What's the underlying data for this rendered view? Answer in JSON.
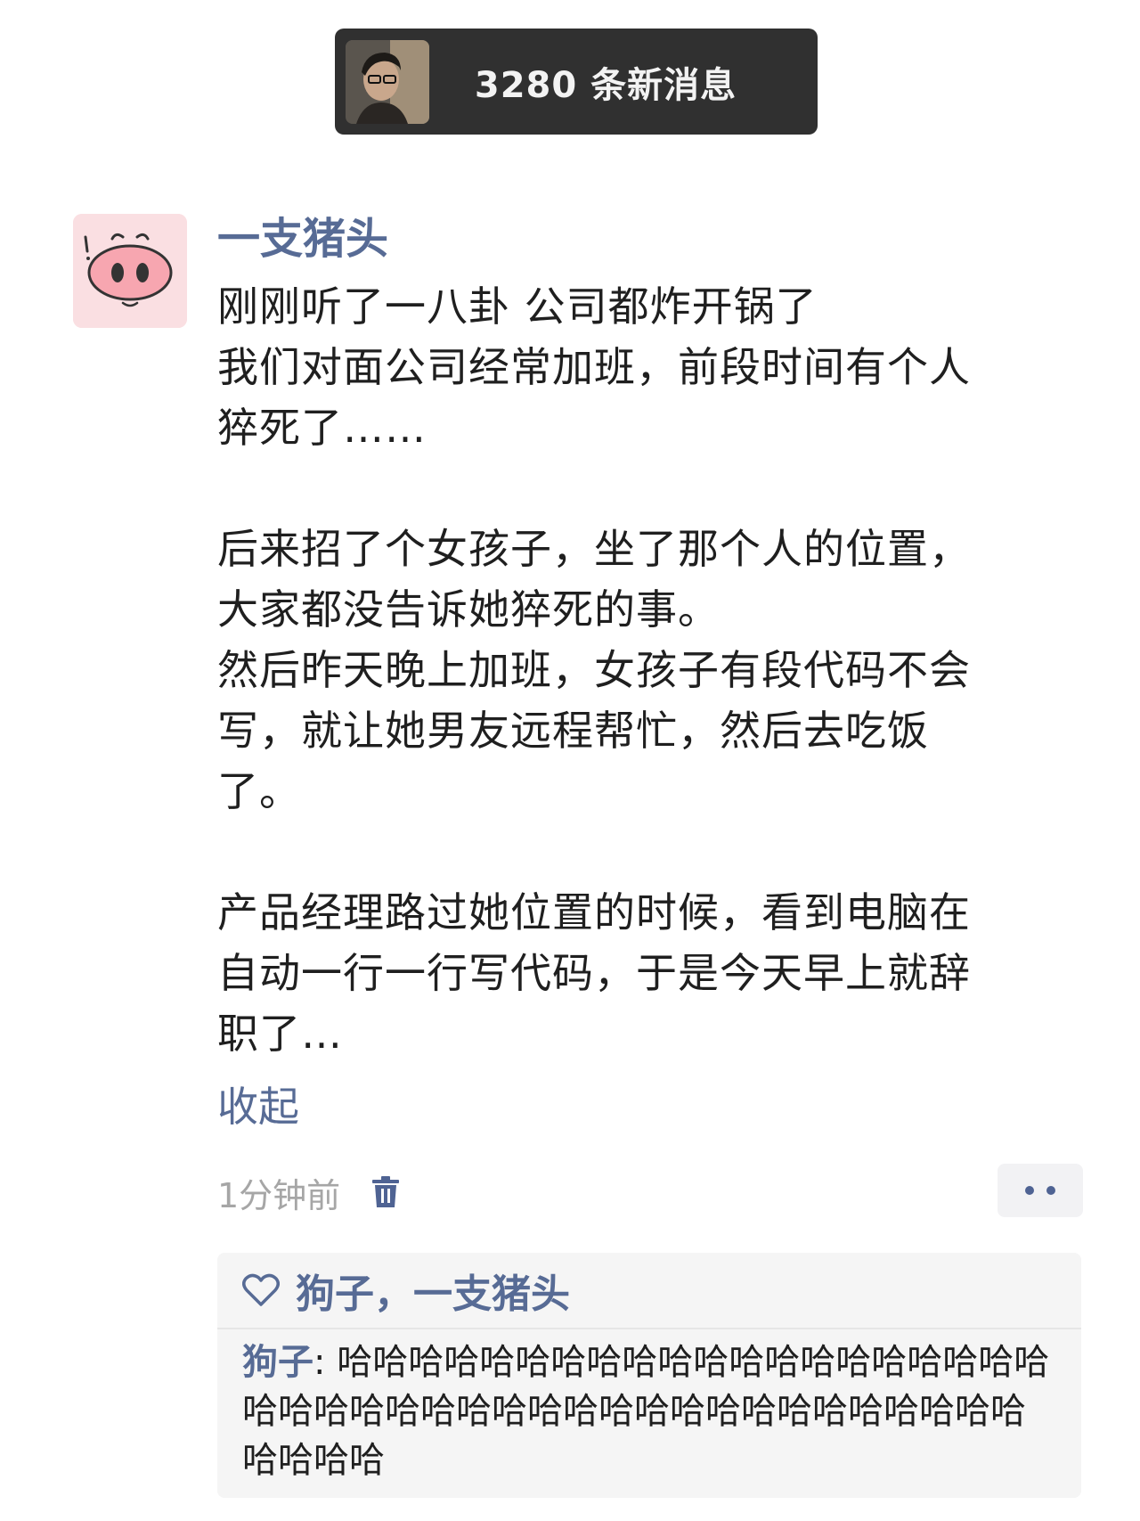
{
  "notification": {
    "count_text": "3280 条新消息"
  },
  "post": {
    "author": "一支猪头",
    "text": "刚刚听了一八卦 公司都炸开锅了\n我们对面公司经常加班，前段时间有个人\n猝死了……\n\n后来招了个女孩子，坐了那个人的位置，\n大家都没告诉她猝死的事。\n然后昨天晚上加班，女孩子有段代码不会\n写，就让她男友远程帮忙，然后去吃饭\n了。\n\n产品经理路过她位置的时候，看到电脑在\n自动一行一行写代码，于是今天早上就辞\n职了…",
    "collapse_label": "收起",
    "time": "1分钟前",
    "likes": "狗子，一支猪头",
    "comment": {
      "author": "狗子",
      "separator": ": ",
      "text": "哈哈哈哈哈哈哈哈哈哈哈哈哈哈哈哈哈哈哈哈哈哈哈哈哈哈哈哈哈哈哈哈哈哈哈哈哈哈哈哈哈哈哈哈哈哈"
    }
  },
  "icons": {
    "pill_avatar": "person-photo-avatar",
    "post_avatar": "pig-snout-avatar",
    "delete": "trash-icon",
    "more": "more-dots-icon",
    "like": "heart-outline-icon"
  },
  "colors": {
    "link": "#576b95",
    "pill_bg": "#303030",
    "avatar_bg": "#fadfe2",
    "meta_gray": "#a6a6a6",
    "panel_bg": "#f5f5f5"
  }
}
